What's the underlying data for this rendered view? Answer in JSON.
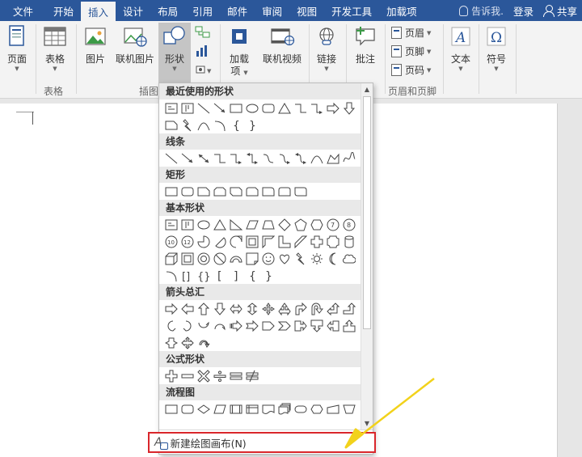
{
  "tabs": {
    "file": "文件",
    "home": "开始",
    "insert": "插入",
    "design": "设计",
    "layout": "布局",
    "references": "引用",
    "mailings": "邮件",
    "review": "审阅",
    "view": "视图",
    "developer": "开发工具",
    "addins": "加载项",
    "tellme": "告诉我.",
    "login": "登录",
    "share": "共享"
  },
  "ribbon": {
    "pages": "页面",
    "table": "表格",
    "table_group": "表格",
    "picture": "图片",
    "online_picture": "联机图片",
    "shapes": "形状",
    "illustrations_group": "插图",
    "addins_btn": "加载",
    "addins_btn2": "项",
    "online_video": "联机视频",
    "link": "链接",
    "comment": "批注",
    "header": "页眉",
    "footer": "页脚",
    "page_number": "页码",
    "header_footer_group": "页眉和页脚",
    "text": "文本",
    "symbol": "符号"
  },
  "shapes_menu": {
    "recent": "最近使用的形状",
    "lines": "线条",
    "rectangles": "矩形",
    "basic": "基本形状",
    "arrows": "箭头总汇",
    "equation": "公式形状",
    "flowchart": "流程图",
    "new_canvas": "新建绘图画布(N)"
  },
  "colors": {
    "accent": "#2b579a",
    "highlight_box": "#d9262b",
    "annotation_arrow": "#f2d21b"
  }
}
